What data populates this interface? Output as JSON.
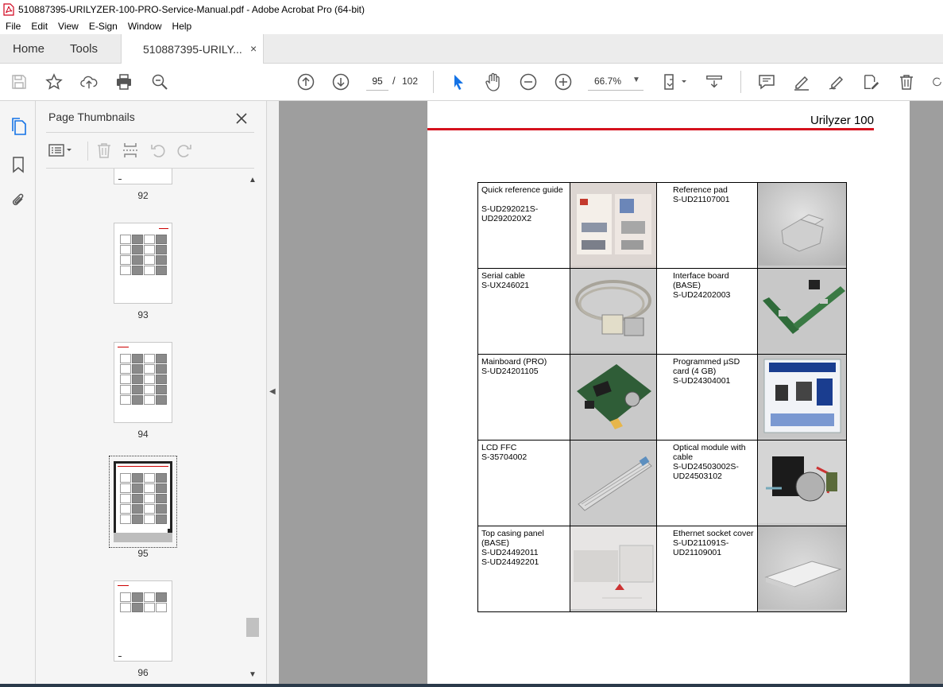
{
  "window": {
    "title": "510887395-URILYZER-100-PRO-Service-Manual.pdf - Adobe Acrobat Pro (64-bit)"
  },
  "menu": [
    "File",
    "Edit",
    "View",
    "E-Sign",
    "Window",
    "Help"
  ],
  "tabs": {
    "home": "Home",
    "tools": "Tools",
    "document": "510887395-URILY...",
    "close": "×"
  },
  "toolbar": {
    "page_current": "95",
    "page_separator": "/",
    "page_total": "102",
    "zoom": "66.7%"
  },
  "sidebar": {
    "panel_title": "Page Thumbnails",
    "thumbnails": [
      {
        "label": "92"
      },
      {
        "label": "93"
      },
      {
        "label": "94"
      },
      {
        "label": "95",
        "selected": true
      },
      {
        "label": "96"
      }
    ]
  },
  "page": {
    "header": "Urilyzer 100",
    "rows": [
      {
        "left_text": "Quick reference guide\n\nS-UD292021S-\nUD292020X2",
        "left_image": "quick-reference-guide-photo",
        "right_text": "Reference pad\nS-UD21107001",
        "right_image": "reference-pad-photo"
      },
      {
        "left_text": "Serial cable\nS-UX246021",
        "left_image": "serial-cable-photo",
        "right_text": "Interface board\n(BASE)\nS-UD24202003",
        "right_image": "interface-board-photo"
      },
      {
        "left_text": "Mainboard (PRO)\nS-UD24201105",
        "left_image": "mainboard-photo",
        "right_text": "Programmed µSD\ncard (4 GB)\nS-UD24304001",
        "right_image": "sd-card-photo"
      },
      {
        "left_text": "LCD FFC\nS-35704002",
        "left_image": "lcd-ffc-photo",
        "right_text": "Optical module with\ncable\nS-UD24503002S-\nUD24503102",
        "right_image": "optical-module-photo"
      },
      {
        "left_text": "Top casing panel\n(BASE)\nS-UD24492011\nS-UD24492201",
        "left_image": "top-casing-panel-photo",
        "right_text": "Ethernet socket cover\nS-UD211091S-\nUD21109001",
        "right_image": "ethernet-socket-cover-photo"
      }
    ]
  },
  "colors": {
    "accent_red": "#d5121e",
    "doc_background": "#9e9e9e",
    "toolbar_blue": "#1473e6"
  }
}
